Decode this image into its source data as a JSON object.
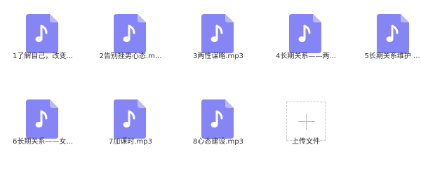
{
  "files": [
    {
      "name": "1了解自己，改变...",
      "icon": "music-file-icon"
    },
    {
      "name": "2告别挫男心态.m...",
      "icon": "music-file-icon"
    },
    {
      "name": "3两性谋略.mp3",
      "icon": "music-file-icon"
    },
    {
      "name": "4长期关系——两...",
      "icon": "music-file-icon"
    },
    {
      "name": "5长期关系维护 ...",
      "icon": "music-file-icon"
    },
    {
      "name": "6长期关系——女...",
      "icon": "music-file-icon"
    },
    {
      "name": "7加课时.mp3",
      "icon": "music-file-icon"
    },
    {
      "name": "8心态建设.mp3",
      "icon": "music-file-icon"
    }
  ],
  "upload": {
    "label": "上传文件",
    "icon": "plus-icon"
  },
  "colors": {
    "file_icon": "#8585f5",
    "file_fold": "#b9b9fa",
    "note": "#ffffff",
    "upload_border": "#c8c8c8",
    "text": "#333333"
  }
}
